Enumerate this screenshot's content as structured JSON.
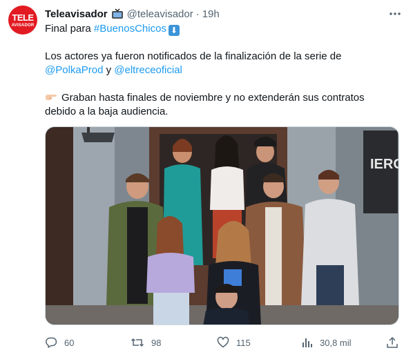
{
  "avatar": {
    "line1": "TELE",
    "line2": "AVISADOR"
  },
  "header": {
    "name": "Teleavisador",
    "handle": "@teleavisador",
    "separator": "·",
    "time": "19h",
    "more_label": "···"
  },
  "body": {
    "line1_prefix": "Final para ",
    "hashtag": "#BuenosChicos",
    "line1_emoji": "⬇",
    "line2": "Los actores ya fueron notificados de la finalización de la serie de",
    "mention1": "@PolkaProd",
    "conj": " y ",
    "mention2": "@eltreceoficial",
    "line3": "Graban hasta finales de noviembre y no extenderán sus contratos",
    "line4": "debido a la baja audiencia."
  },
  "photo": {
    "sign_text": "IERC"
  },
  "actions": {
    "replies": "60",
    "retweets": "98",
    "likes": "115",
    "views": "30,8 mil"
  },
  "colors": {
    "accent": "#1d9bf0",
    "brand": "#e21a22",
    "muted": "#536471"
  }
}
